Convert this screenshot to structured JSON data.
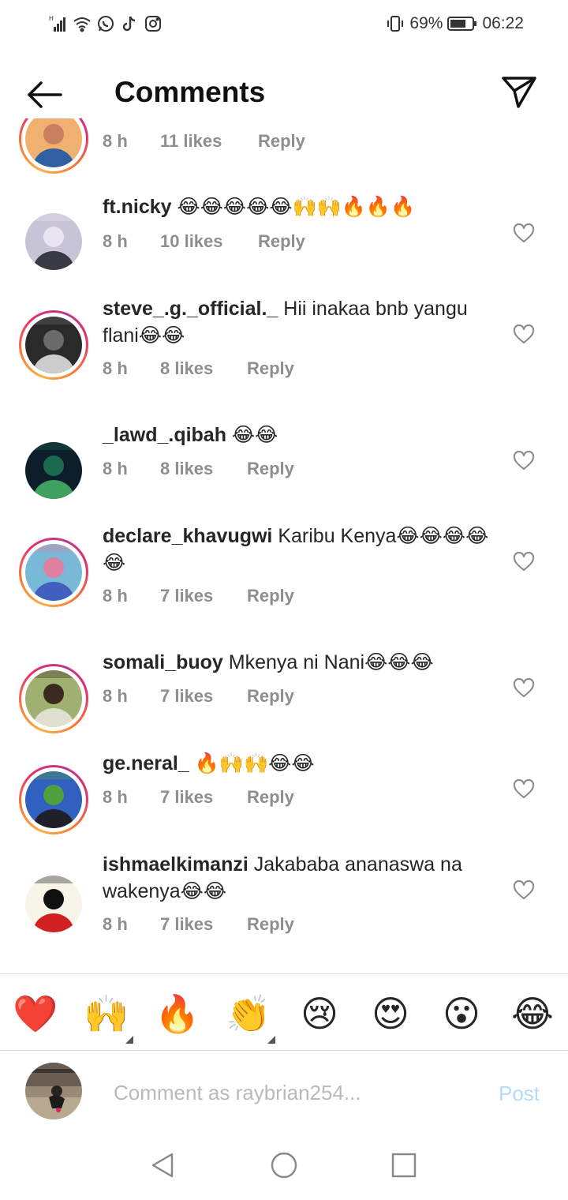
{
  "status_bar": {
    "battery": "69%",
    "time": "06:22",
    "icons": [
      "signal-icon",
      "wifi-icon",
      "whatsapp-icon",
      "tiktok-icon",
      "instagram-icon",
      "vibrate-icon",
      "battery-icon"
    ]
  },
  "header": {
    "title": "Comments",
    "back_icon": "arrow-left-icon",
    "share_icon": "paper-plane-icon"
  },
  "comments": [
    {
      "username": "",
      "text": "",
      "time": "8 h",
      "likes": "11 likes",
      "reply": "Reply",
      "story_ring": true,
      "avatar_colors": [
        "#f0b070",
        "#c88060",
        "#3060a0"
      ]
    },
    {
      "username": "ft.nicky",
      "text": " 😂😂😂😂😂🙌🙌🔥🔥🔥",
      "time": "8 h",
      "likes": "10 likes",
      "reply": "Reply",
      "story_ring": false,
      "avatar_colors": [
        "#c8c4d8",
        "#e8e4f0",
        "#3a3a44"
      ]
    },
    {
      "username": "steve_.g._official._",
      "text": " Hii inakaa bnb yangu flani😂😂",
      "time": "8 h",
      "likes": "8 likes",
      "reply": "Reply",
      "story_ring": true,
      "avatar_colors": [
        "#2a2a2a",
        "#6a6a6a",
        "#cccccc"
      ]
    },
    {
      "username": "_lawd_.qibah",
      "text": " 😂😂",
      "time": "8 h",
      "likes": "8 likes",
      "reply": "Reply",
      "story_ring": false,
      "avatar_colors": [
        "#0d1d2a",
        "#1a6a50",
        "#3fa060"
      ]
    },
    {
      "username": "declare_khavugwi",
      "text": " Karibu Kenya😂😂😂😂😂",
      "time": "8 h",
      "likes": "7 likes",
      "reply": "Reply",
      "story_ring": true,
      "avatar_colors": [
        "#7ab8d8",
        "#e080a0",
        "#4060c0"
      ]
    },
    {
      "username": "somali_buoy",
      "text": " Mkenya ni Nani😂😂😂",
      "time": "8 h",
      "likes": "7 likes",
      "reply": "Reply",
      "story_ring": true,
      "avatar_colors": [
        "#a0b070",
        "#3a2a20",
        "#e0e0d0"
      ]
    },
    {
      "username": "ge.neral_",
      "text": " 🔥🙌🙌😂😂",
      "time": "8 h",
      "likes": "7 likes",
      "reply": "Reply",
      "story_ring": true,
      "avatar_colors": [
        "#3060c0",
        "#50a040",
        "#20202a"
      ]
    },
    {
      "username": "ishmaelkimanzi",
      "text": " Jakababa ananaswa na wakenya😂😂",
      "time": "8 h",
      "likes": "7 likes",
      "reply": "Reply",
      "story_ring": false,
      "avatar_colors": [
        "#f8f4e8",
        "#101010",
        "#d02020"
      ]
    }
  ],
  "emoji_bar": [
    "❤️",
    "🙌",
    "🔥",
    "👏",
    "😢",
    "😍",
    "😮",
    "😂"
  ],
  "composer": {
    "placeholder": "Comment as raybrian254...",
    "post_label": "Post",
    "post_color": "#b3dbff"
  },
  "navbar": {
    "icons": [
      "nav-back-icon",
      "nav-home-icon",
      "nav-recents-icon"
    ]
  },
  "colors": {
    "text": "#262626",
    "meta": "#8e8e8e",
    "divider": "#dbdbdb"
  }
}
